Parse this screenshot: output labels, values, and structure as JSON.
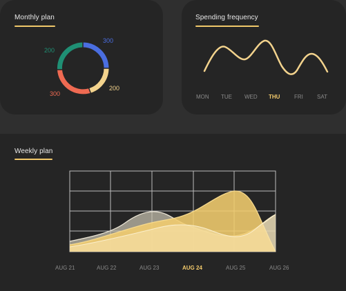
{
  "monthly_plan": {
    "title": "Monthly plan",
    "segments": [
      {
        "value": "300",
        "color": "#4a6ee0"
      },
      {
        "value": "200",
        "color": "#f3d38d"
      },
      {
        "value": "300",
        "color": "#ef6a52"
      },
      {
        "value": "200",
        "color": "#1f8f74"
      }
    ]
  },
  "spending_frequency": {
    "title": "Spending frequency",
    "days": [
      "MON",
      "TUE",
      "WED",
      "THU",
      "FRI",
      "SAT"
    ],
    "active_day": "THU",
    "line_color": "#f3d38d"
  },
  "weekly_plan": {
    "title": "Weekly plan",
    "dates": [
      "AUG 21",
      "AUG 22",
      "AUG 23",
      "AUG 24",
      "AUG 25",
      "AUG 26"
    ],
    "active_date": "AUG 24",
    "accent": "#f2c96b"
  }
}
